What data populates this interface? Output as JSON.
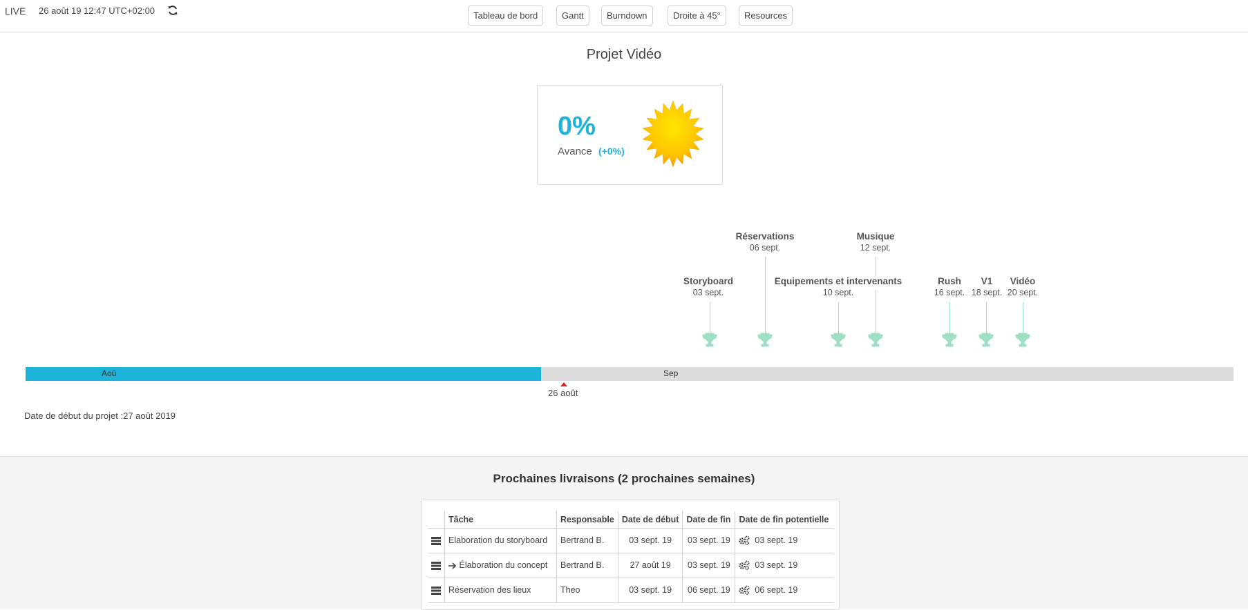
{
  "topbar": {
    "live": "LIVE",
    "datetime": "26 août 19  12:47 UTC+02:00",
    "refresh_icon": "refresh-icon",
    "nav": [
      "Tableau de bord",
      "Gantt",
      "Burndown",
      "Droite à 45°",
      "Resources"
    ]
  },
  "project": {
    "title": "Projet Vidéo",
    "progress": "0%",
    "progress_label": "Avance",
    "progress_delta": "(+0%)",
    "weather_icon": "sun-icon"
  },
  "milestones": [
    {
      "name": "Storyboard",
      "date": "03 sept."
    },
    {
      "name": "Réservations",
      "date": "06 sept."
    },
    {
      "name": "Equipements et intervenants",
      "date": "10 sept."
    },
    {
      "name": "Musique",
      "date": "12 sept."
    },
    {
      "name": "Rush",
      "date": "16 sept."
    },
    {
      "name": "V1",
      "date": "18 sept."
    },
    {
      "name": "Vidéo",
      "date": "20 sept."
    }
  ],
  "timeline": {
    "month_1": "Aoû",
    "month_2": "Sep",
    "today": "26 août",
    "start_date": "Date de début du projet :27 août 2019"
  },
  "deliveries": {
    "title": "Prochaines livraisons (2 prochaines semaines)",
    "columns": [
      "",
      "Tâche",
      "Responsable",
      "Date de début",
      "Date de fin",
      "Date de fin potentielle"
    ],
    "rows": [
      {
        "task": "Elaboration du storyboard",
        "sub": false,
        "owner": "Bertrand B.",
        "start": "03 sept. 19",
        "end": "03 sept. 19",
        "potential": "03 sept. 19"
      },
      {
        "task": "Élaboration du concept",
        "sub": true,
        "owner": "Bertrand B.",
        "start": "27 août 19",
        "end": "03 sept. 19",
        "potential": "03 sept. 19"
      },
      {
        "task": "Réservation des lieux",
        "sub": false,
        "owner": "Theo",
        "start": "03 sept. 19",
        "end": "06 sept. 19",
        "potential": "06 sept. 19"
      }
    ]
  },
  "colors": {
    "accent": "#1eb3d9",
    "milestone": "#9fe0c5",
    "today_marker": "#e02020"
  }
}
